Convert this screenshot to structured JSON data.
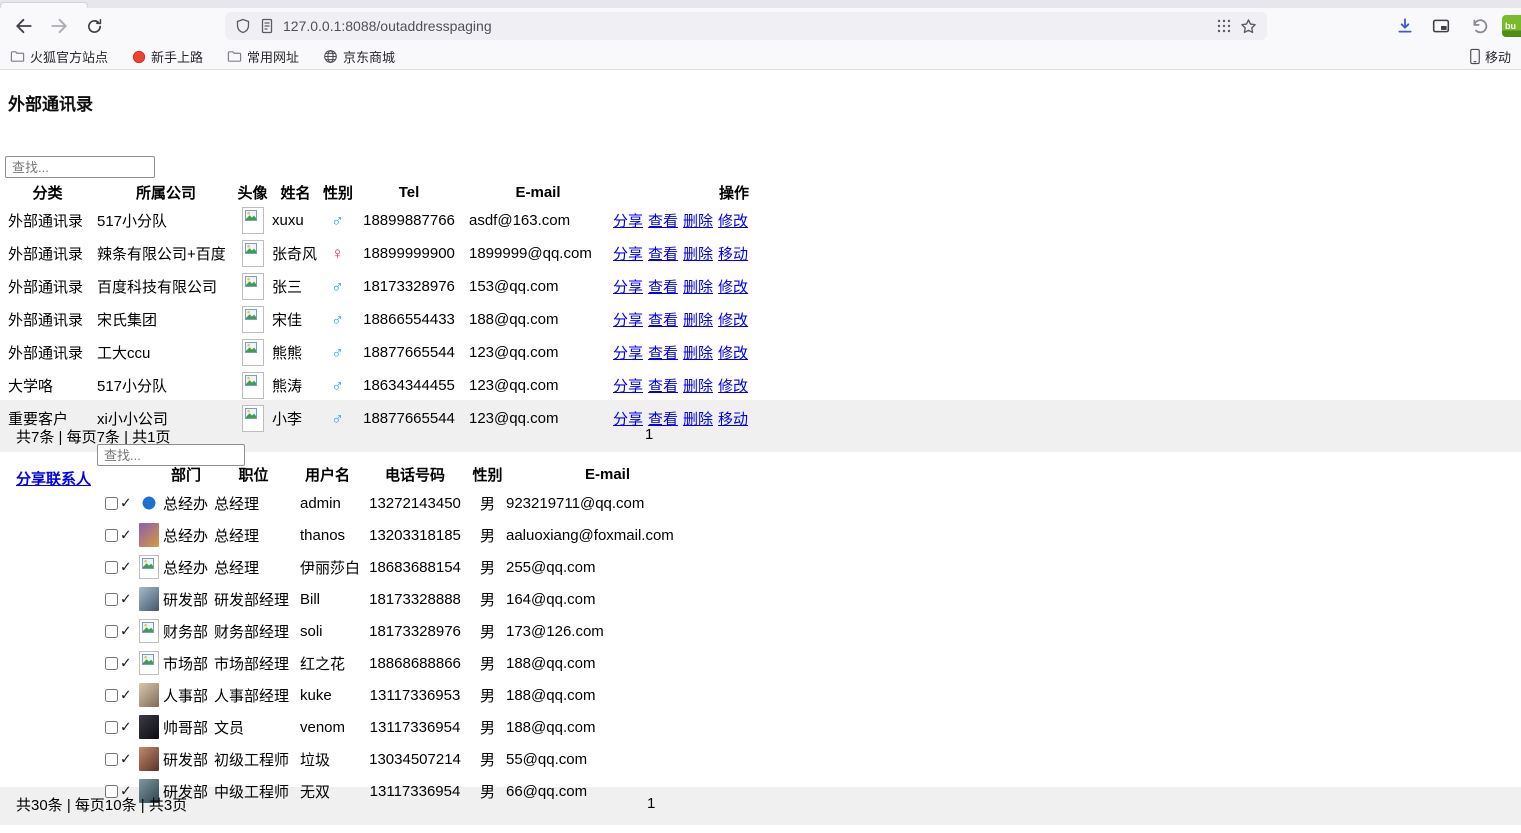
{
  "browser": {
    "url": "127.0.0.1:8088/outaddresspaging",
    "ext_badge": "bu",
    "bookmarks": [
      "火狐官方站点",
      "新手上路",
      "常用网址",
      "京东商城"
    ],
    "bookmarks_right": "移动"
  },
  "page": {
    "title": "外部通讯录",
    "search_placeholder": "查找...",
    "search2_placeholder": "查找...",
    "share_link": "分享联系人",
    "check_mark": "✓",
    "colors": {
      "male": "#29a3dd",
      "female": "#ee3044",
      "link": "#0000ee"
    },
    "table1": {
      "headers": [
        "分类",
        "所属公司",
        "头像",
        "姓名",
        "性别",
        "Tel",
        "E-mail",
        "操作"
      ],
      "rows": [
        {
          "category": "外部通讯录",
          "company": "517小分队",
          "name": "xuxu",
          "gender": "♂",
          "tel": "18899887766",
          "email": "asdf@163.com",
          "actions": [
            "分享",
            "查看",
            "删除",
            "修改"
          ]
        },
        {
          "category": "外部通讯录",
          "company": "辣条有限公司+百度",
          "name": "张奇风",
          "gender": "♀",
          "tel": "18899999900",
          "email": "1899999@qq.com",
          "actions": [
            "分享",
            "查看",
            "删除",
            "移动"
          ]
        },
        {
          "category": "外部通讯录",
          "company": "百度科技有限公司",
          "name": "张三",
          "gender": "♂",
          "tel": "18173328976",
          "email": "153@qq.com",
          "actions": [
            "分享",
            "查看",
            "删除",
            "修改"
          ]
        },
        {
          "category": "外部通讯录",
          "company": "宋氏集团",
          "name": "宋佳",
          "gender": "♂",
          "tel": "18866554433",
          "email": "188@qq.com",
          "actions": [
            "分享",
            "查看",
            "删除",
            "修改"
          ]
        },
        {
          "category": "外部通讯录",
          "company": "工大ccu",
          "name": "熊熊",
          "gender": "♂",
          "tel": "18877665544",
          "email": "123@qq.com",
          "actions": [
            "分享",
            "查看",
            "删除",
            "修改"
          ]
        },
        {
          "category": "大学咯",
          "company": "517小分队",
          "name": "熊涛",
          "gender": "♂",
          "tel": "18634344455",
          "email": "123@qq.com",
          "actions": [
            "分享",
            "查看",
            "删除",
            "修改"
          ]
        },
        {
          "category": "重要客户",
          "company": "xi小小公司",
          "name": "小李",
          "gender": "♂",
          "tel": "18877665544",
          "email": "123@qq.com",
          "actions": [
            "分享",
            "查看",
            "删除",
            "移动"
          ]
        }
      ],
      "pagination": "共7条 | 每页7条 | 共1页",
      "page_number": "1"
    },
    "table2": {
      "headers": [
        "部门",
        "职位",
        "用户名",
        "电话号码",
        "性别",
        "E-mail"
      ],
      "rows": [
        {
          "avatar": {
            "kind": "logo",
            "colors": [
              "#1d6fd4",
              "#ffffff"
            ]
          },
          "dept": "总经办",
          "title": "总经理",
          "username": "admin",
          "phone": "13272143450",
          "gender": "男",
          "email": "923219711@qq.com"
        },
        {
          "avatar": {
            "kind": "photo",
            "colors": [
              "#8a5fb0",
              "#d89a3c"
            ]
          },
          "dept": "总经办",
          "title": "总经理",
          "username": "thanos",
          "phone": "13203318185",
          "gender": "男",
          "email": "aaluoxiang@foxmail.com"
        },
        {
          "avatar": {
            "kind": "broken"
          },
          "dept": "总经办",
          "title": "总经理",
          "username": "伊丽莎白",
          "phone": "18683688154",
          "gender": "男",
          "email": "255@qq.com"
        },
        {
          "avatar": {
            "kind": "photo",
            "colors": [
              "#a8bccb",
              "#41566b"
            ]
          },
          "dept": "研发部",
          "title": "研发部经理",
          "username": "Bill",
          "phone": "18173328888",
          "gender": "男",
          "email": "164@qq.com"
        },
        {
          "avatar": {
            "kind": "broken"
          },
          "dept": "财务部",
          "title": "财务部经理",
          "username": "soli",
          "phone": "18173328976",
          "gender": "男",
          "email": "173@126.com"
        },
        {
          "avatar": {
            "kind": "broken"
          },
          "dept": "市场部",
          "title": "市场部经理",
          "username": "红之花",
          "phone": "18868688866",
          "gender": "男",
          "email": "188@qq.com"
        },
        {
          "avatar": {
            "kind": "photo",
            "colors": [
              "#d8c8b2",
              "#7e6a55"
            ]
          },
          "dept": "人事部",
          "title": "人事部经理",
          "username": "kuke",
          "phone": "13117336953",
          "gender": "男",
          "email": "188@qq.com"
        },
        {
          "avatar": {
            "kind": "photo",
            "colors": [
              "#3a3a44",
              "#0c0c12"
            ]
          },
          "dept": "帅哥部",
          "title": "文员",
          "username": "venom",
          "phone": "13117336954",
          "gender": "男",
          "email": "188@qq.com"
        },
        {
          "avatar": {
            "kind": "photo",
            "colors": [
              "#c28a6e",
              "#5a322a"
            ]
          },
          "dept": "研发部",
          "title": "初级工程师",
          "username": "垃圾",
          "phone": "13034507214",
          "gender": "男",
          "email": "55@qq.com"
        },
        {
          "avatar": {
            "kind": "photo",
            "colors": [
              "#7e98a2",
              "#2f434c"
            ]
          },
          "dept": "研发部",
          "title": "中级工程师",
          "username": "无双",
          "phone": "13117336954",
          "gender": "男",
          "email": "66@qq.com"
        }
      ],
      "pagination": "共30条 | 每页10条 | 共3页",
      "page_number": "1"
    }
  }
}
